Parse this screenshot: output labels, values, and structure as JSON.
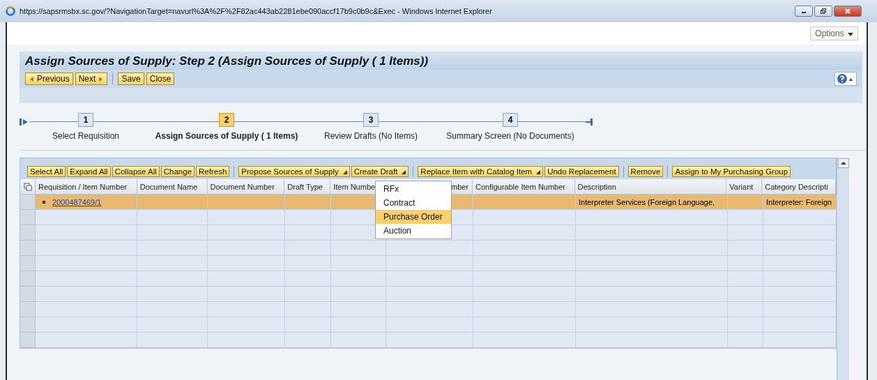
{
  "browser": {
    "title": "https://sapsrmsbx.sc.gov/?NavigationTarget=navurl%3A%2F%2F82ac443ab2281ebe090accf17b9c0b9c&Exec - Windows Internet Explorer"
  },
  "options": {
    "label": "Options"
  },
  "page": {
    "title": "Assign Sources of Supply: Step 2 (Assign Sources of Supply ( 1 Items))"
  },
  "nav_buttons": [
    {
      "label": "Previous",
      "kind": "prev"
    },
    {
      "label": "Next",
      "kind": "next"
    },
    {
      "label": "Save",
      "kind": "plain",
      "group_start": true
    },
    {
      "label": "Close",
      "kind": "plain"
    }
  ],
  "steps": [
    {
      "number": "1",
      "label": "Select Requisition",
      "selected": false
    },
    {
      "number": "2",
      "label": "Assign Sources of Supply ( 1 Items)",
      "selected": true
    },
    {
      "number": "3",
      "label": "Review Drafts (No Items)",
      "selected": false
    },
    {
      "number": "4",
      "label": "Summary Screen (No Documents)",
      "selected": false
    }
  ],
  "toolbar": [
    {
      "label": "Select All",
      "kind": "plain"
    },
    {
      "label": "Expand All",
      "kind": "plain"
    },
    {
      "label": "Collapse All",
      "kind": "plain"
    },
    {
      "label": "Change",
      "kind": "plain"
    },
    {
      "label": "Refresh",
      "kind": "plain"
    },
    {
      "label": "Propose Sources of Supply",
      "kind": "dropdown",
      "group_start": true
    },
    {
      "label": "Create Draft",
      "kind": "dropdown"
    },
    {
      "label": "Replace Item with Catalog Item",
      "kind": "dropdown",
      "group_start": true
    },
    {
      "label": "Undo Replacement",
      "kind": "plain"
    },
    {
      "label": "Remove",
      "kind": "plain",
      "group_start": true
    },
    {
      "label": "Assign to My Purchasing Group",
      "kind": "plain",
      "group_start": true
    }
  ],
  "menu": [
    {
      "label": "RFx",
      "selected": false
    },
    {
      "label": "Contract",
      "selected": false
    },
    {
      "label": "Purchase Order",
      "selected": true
    },
    {
      "label": "Auction",
      "selected": false
    }
  ],
  "table": {
    "columns": [
      "Requisition / Item Number",
      "Document Name",
      "Document Number",
      "Draft Type",
      "Item Numbe",
      "mber",
      "Configurable Item Number",
      "Description",
      "Variant",
      "Category Descripti"
    ],
    "rows": [
      {
        "selected": true,
        "cells": [
          "2000487469/1",
          "",
          "",
          "",
          "",
          "",
          "",
          "Interpreter Services (Foreign Language,",
          "",
          "Interpreter: Foreign"
        ]
      }
    ]
  }
}
